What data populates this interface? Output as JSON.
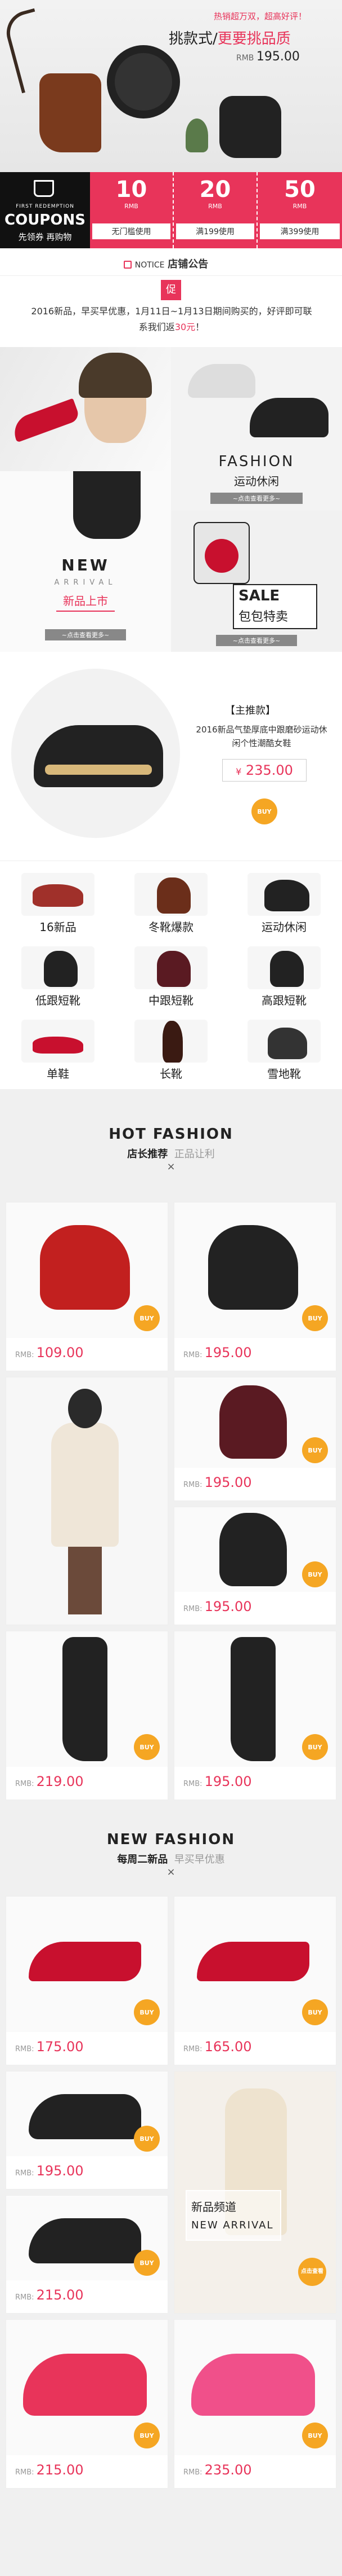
{
  "top_banner": {
    "slogan": "热销超万双，超高好评！",
    "title_a": "挑款式/",
    "title_b": "更要挑品质",
    "price_label": "RMB",
    "price": "195.00"
  },
  "coupons": {
    "tag_small": "FIRST REDEMPTION",
    "tag_big": "COUPONS",
    "tag_cn": "先领券  再购物",
    "items": [
      {
        "amount": "10",
        "unit": "RMB",
        "cond": "无门槛使用"
      },
      {
        "amount": "20",
        "unit": "RMB",
        "cond": "满199使用"
      },
      {
        "amount": "50",
        "unit": "RMB",
        "cond": "满399使用"
      }
    ]
  },
  "notice": {
    "label_en": "NOTICE",
    "label_cn": "店铺公告",
    "badge": "促",
    "text_a": "2016新品，早买早优惠，1月11日~1月13日期间购买的，好评即可联系我们返",
    "text_highlight": "30元",
    "text_b": "！"
  },
  "features": {
    "fashion_en": "FASHION",
    "fashion_cn": "运动休闲",
    "fashion_more": "~点击查看更多~",
    "new_en": "NEW",
    "arrival_en": "ARRIVAL",
    "new_cn": "新品上市",
    "new_more": "~点击查看更多~",
    "sale_en": "SALE",
    "sale_cn": "包包特卖",
    "sale_more": "~点击查看更多~"
  },
  "main_product": {
    "tag": "【主推款】",
    "desc": "2016新品气垫厚底中跟磨砂运动休闲个性潮酷女鞋",
    "currency": "¥",
    "price": "235.00",
    "buy": "BUY"
  },
  "categories": [
    {
      "label": "16新品"
    },
    {
      "label": "冬靴爆款"
    },
    {
      "label": "运动休闲"
    },
    {
      "label": "低跟短靴"
    },
    {
      "label": "中跟短靴"
    },
    {
      "label": "高跟短靴"
    },
    {
      "label": "单鞋"
    },
    {
      "label": "长靴"
    },
    {
      "label": "雪地靴"
    }
  ],
  "hot": {
    "en": "HOT FASHION",
    "cn_a": "店长推荐",
    "cn_b": "正品让利",
    "x": "×",
    "prices": [
      "109.00",
      "195.00",
      "195.00",
      "195.00",
      "219.00",
      "195.00"
    ],
    "rmb": "RMB:",
    "buy": "BUY"
  },
  "new": {
    "en": "NEW FASHION",
    "cn_a": "每周二新品",
    "cn_b": "早买早优惠",
    "x": "×",
    "prices": [
      "175.00",
      "165.00",
      "195.00",
      "215.00",
      "215.00",
      "235.00"
    ],
    "rmb": "RMB:",
    "buy": "BUY",
    "channel_cn": "新品频道",
    "channel_en": "NEW ARRIVAL",
    "channel_btn": "点击查看"
  }
}
